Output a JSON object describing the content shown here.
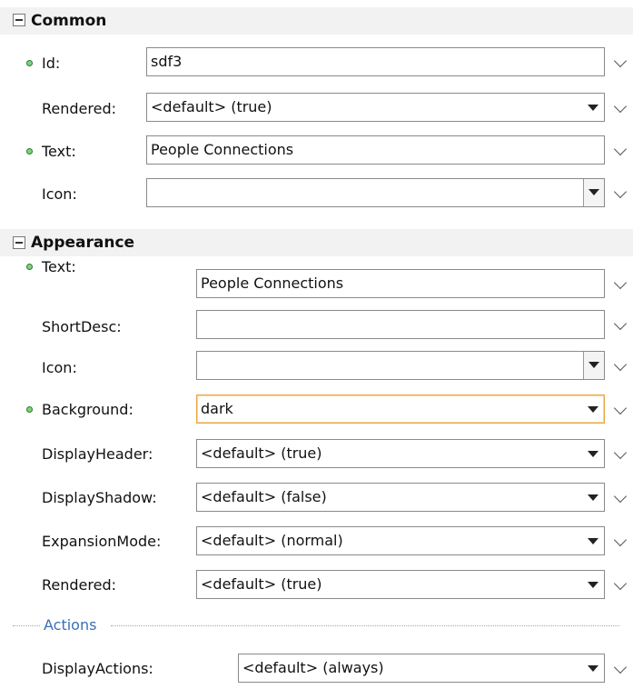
{
  "common": {
    "title": "Common",
    "rows": [
      {
        "label": "Id:",
        "value": "sdf3",
        "required": true
      },
      {
        "label": "Rendered:",
        "value": "<default> (true)",
        "required": false
      },
      {
        "label": "Text:",
        "value": "People Connections",
        "required": true
      },
      {
        "label": "Icon:",
        "value": "",
        "required": false
      }
    ]
  },
  "appearance": {
    "title": "Appearance",
    "rows": [
      {
        "label": "Text:",
        "value": "People Connections",
        "required": true
      },
      {
        "label": "ShortDesc:",
        "value": "",
        "required": false
      },
      {
        "label": "Icon:",
        "value": "",
        "required": false
      },
      {
        "label": "Background:",
        "value": "dark",
        "required": true
      },
      {
        "label": "DisplayHeader:",
        "value": "<default> (true)",
        "required": false
      },
      {
        "label": "DisplayShadow:",
        "value": "<default> (false)",
        "required": false
      },
      {
        "label": "ExpansionMode:",
        "value": "<default> (normal)",
        "required": false
      },
      {
        "label": "Rendered:",
        "value": "<default> (true)",
        "required": false
      }
    ]
  },
  "actions": {
    "title": "Actions",
    "rows": [
      {
        "label": "DisplayActions:",
        "value": "<default> (always)",
        "required": false
      }
    ]
  },
  "colors": {
    "focus_border": "#e9a640",
    "required_dot": "#7fd37f",
    "subsection_title": "#3a6fb5"
  }
}
